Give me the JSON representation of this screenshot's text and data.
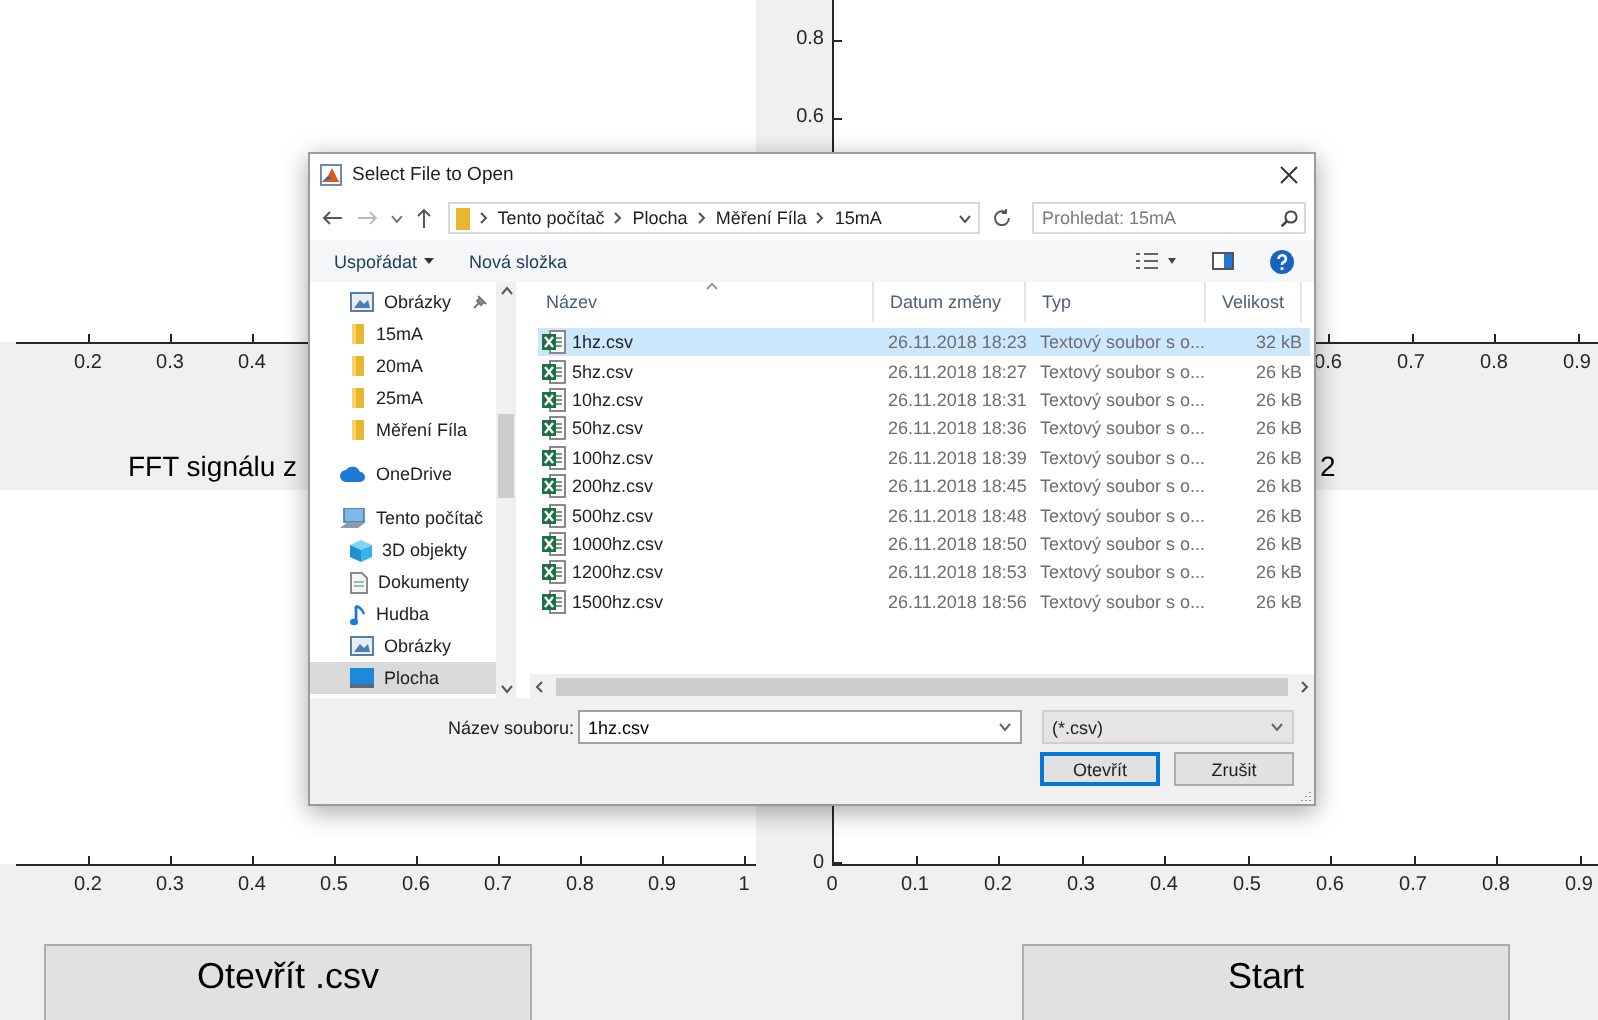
{
  "figure": {
    "plots": [
      {
        "x_ticks": [
          "0.2",
          "0.3",
          "0.4"
        ]
      },
      {
        "x_ticks": [
          "0.6",
          "0.7",
          "0.8",
          "0.9"
        ],
        "y_ticks": [
          "0.8",
          "0.6"
        ]
      },
      {
        "x_ticks": [
          "0.2",
          "0.3",
          "0.4",
          "0.5",
          "0.6",
          "0.7",
          "0.8",
          "0.9",
          "1"
        ]
      },
      {
        "x_ticks": [
          "0",
          "0.1",
          "0.2",
          "0.3",
          "0.4",
          "0.5",
          "0.6",
          "0.7",
          "0.8",
          "0.9"
        ],
        "y_ticks": [
          "0"
        ]
      }
    ],
    "titles": [
      "FFT signálu z",
      "2"
    ],
    "buttons": [
      "Otevřít .csv",
      "Start"
    ]
  },
  "dialog": {
    "title": "Select File to Open",
    "breadcrumb": [
      "Tento počítač",
      "Plocha",
      "Měření Fíla",
      "15mA"
    ],
    "search": {
      "placeholder": "Prohledat: 15mA"
    },
    "toolbar": [
      "Uspořádat",
      "Nová složka"
    ],
    "nav": [
      {
        "label": "Obrázky",
        "kind": "pictures",
        "pinned": true,
        "selected": false
      },
      {
        "label": "15mA",
        "kind": "folder",
        "pinned": false,
        "selected": false
      },
      {
        "label": "20mA",
        "kind": "folder",
        "pinned": false,
        "selected": false
      },
      {
        "label": "25mA",
        "kind": "folder",
        "pinned": false,
        "selected": false
      },
      {
        "label": "Měření Fíla",
        "kind": "folder",
        "pinned": false,
        "selected": false
      },
      {
        "label": "OneDrive",
        "kind": "cloud",
        "pinned": false,
        "selected": false
      },
      {
        "label": "Tento počítač",
        "kind": "computer",
        "pinned": false,
        "selected": false,
        "children": [
          {
            "label": "3D objekty",
            "kind": "cube",
            "pinned": false,
            "selected": false
          },
          {
            "label": "Dokumenty",
            "kind": "document",
            "pinned": false,
            "selected": false
          },
          {
            "label": "Hudba",
            "kind": "music",
            "pinned": false,
            "selected": false
          },
          {
            "label": "Obrázky",
            "kind": "pictures",
            "pinned": false,
            "selected": false
          },
          {
            "label": "Plocha",
            "kind": "desktop",
            "pinned": false,
            "selected": true
          }
        ]
      }
    ],
    "columns": [
      "Název",
      "Datum změny",
      "Typ",
      "Velikost"
    ],
    "files": [
      {
        "name": "1hz.csv",
        "modified": "26.11.2018 18:23",
        "type": "Textový soubor s o...",
        "size": "32 kB",
        "selected": true
      },
      {
        "name": "5hz.csv",
        "modified": "26.11.2018 18:27",
        "type": "Textový soubor s o...",
        "size": "26 kB",
        "selected": false
      },
      {
        "name": "10hz.csv",
        "modified": "26.11.2018 18:31",
        "type": "Textový soubor s o...",
        "size": "26 kB",
        "selected": false
      },
      {
        "name": "50hz.csv",
        "modified": "26.11.2018 18:36",
        "type": "Textový soubor s o...",
        "size": "26 kB",
        "selected": false
      },
      {
        "name": "100hz.csv",
        "modified": "26.11.2018 18:39",
        "type": "Textový soubor s o...",
        "size": "26 kB",
        "selected": false
      },
      {
        "name": "200hz.csv",
        "modified": "26.11.2018 18:45",
        "type": "Textový soubor s o...",
        "size": "26 kB",
        "selected": false
      },
      {
        "name": "500hz.csv",
        "modified": "26.11.2018 18:48",
        "type": "Textový soubor s o...",
        "size": "26 kB",
        "selected": false
      },
      {
        "name": "1000hz.csv",
        "modified": "26.11.2018 18:50",
        "type": "Textový soubor s o...",
        "size": "26 kB",
        "selected": false
      },
      {
        "name": "1200hz.csv",
        "modified": "26.11.2018 18:53",
        "type": "Textový soubor s o...",
        "size": "26 kB",
        "selected": false
      },
      {
        "name": "1500hz.csv",
        "modified": "26.11.2018 18:56",
        "type": "Textový soubor s o...",
        "size": "26 kB",
        "selected": false
      }
    ],
    "file_name_label": "Název souboru:",
    "file_name": "1hz.csv",
    "filter": "(*.csv)",
    "buttons": [
      {
        "label": "Otevřít",
        "default": true
      },
      {
        "label": "Zrušit",
        "default": false
      }
    ]
  }
}
